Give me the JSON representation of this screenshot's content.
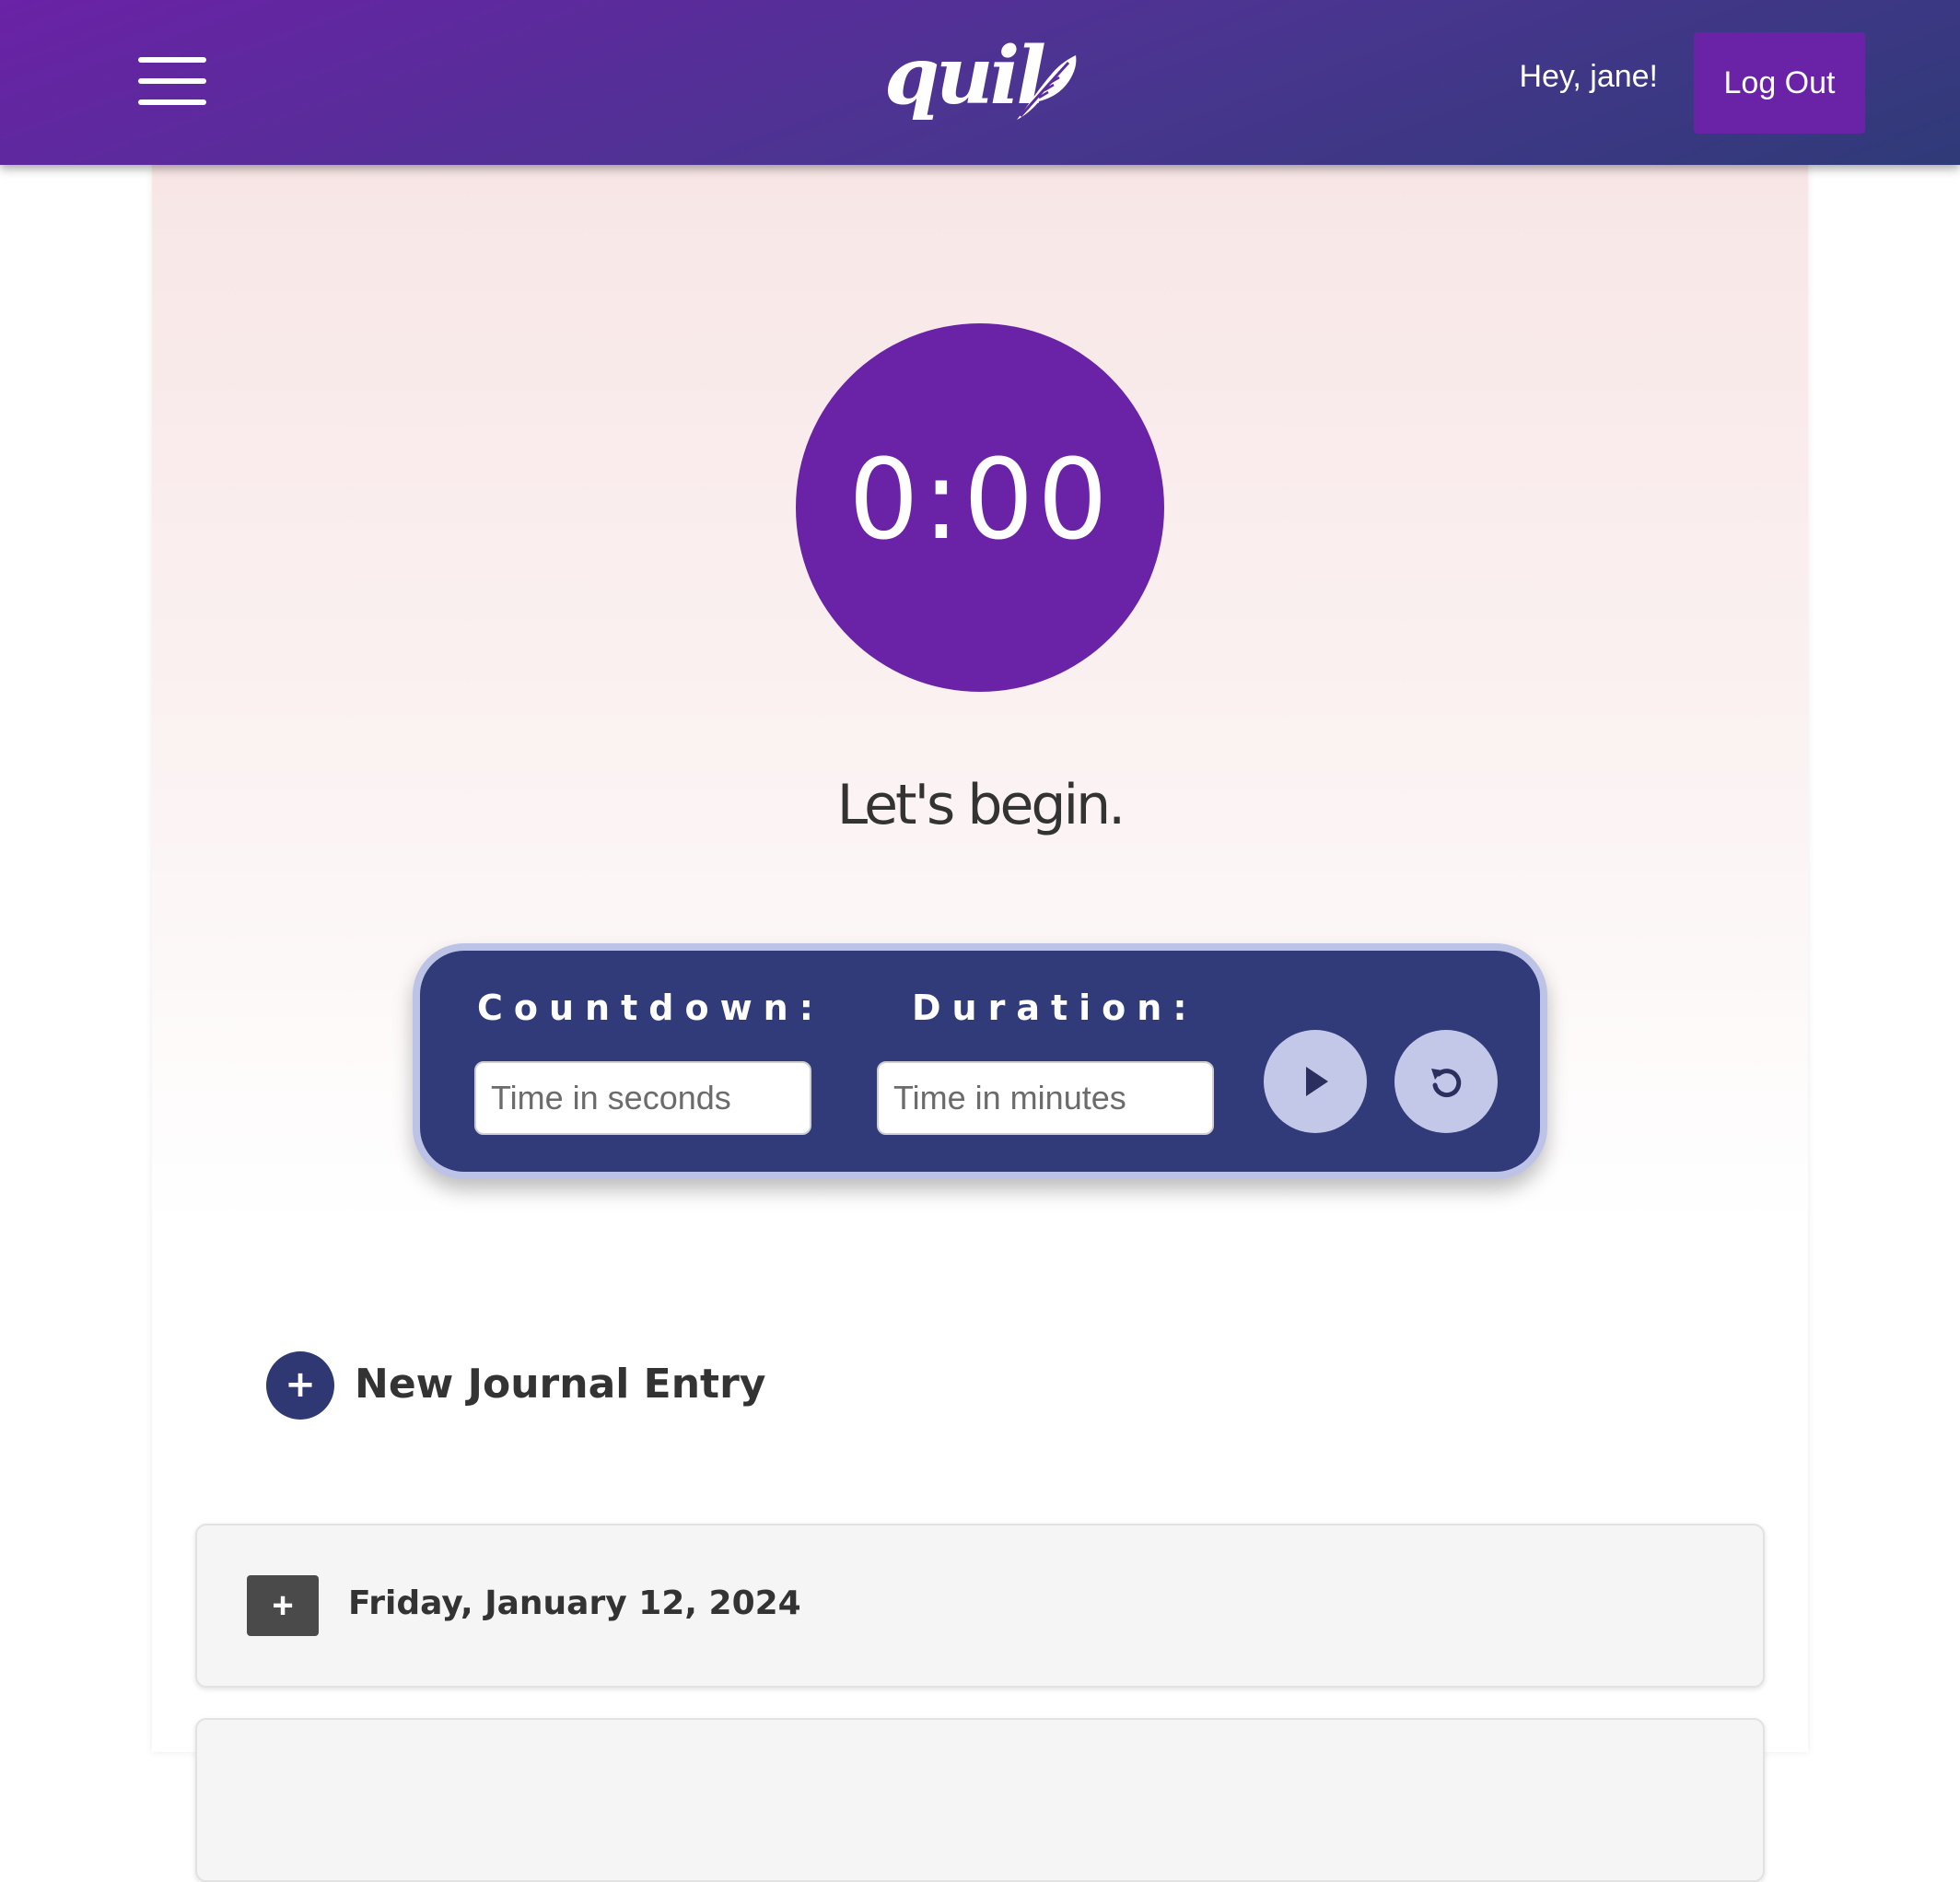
{
  "header": {
    "logo_text": "quil",
    "greeting": "Hey, jane!",
    "logout_label": "Log Out",
    "colors": {
      "gradient_start": "#6a22a6",
      "gradient_end": "#2f3a78",
      "logout_bg": "#6a22a6"
    }
  },
  "timer": {
    "display": "0:00",
    "prompt": "Let's begin.",
    "circle_color": "#6a22a6"
  },
  "controls": {
    "countdown_label": "Countdown:",
    "countdown_placeholder": "Time in seconds",
    "duration_label": "Duration:",
    "duration_placeholder": "Time in minutes",
    "play_icon": "play-icon",
    "reset_icon": "reset-icon",
    "panel_color": "#313b79",
    "button_color": "#c4c8e8"
  },
  "journal": {
    "new_entry_label": "New Journal Entry",
    "new_entry_symbol": "+",
    "entries": [
      {
        "date": "Friday, January 12, 2024",
        "toggle_symbol": "+"
      },
      {
        "date": "",
        "toggle_symbol": ""
      }
    ]
  }
}
